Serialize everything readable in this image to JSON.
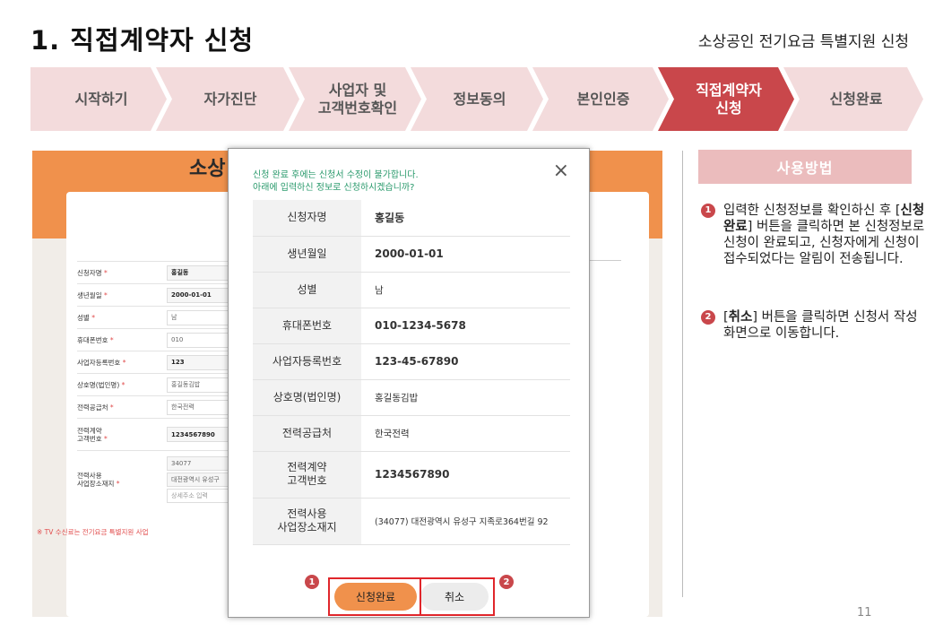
{
  "header": {
    "title": "1. 직접계약자 신청",
    "subtitle": "소상공인 전기요금 특별지원 신청"
  },
  "steps": [
    {
      "label": "시작하기",
      "active": false
    },
    {
      "label": "자가진단",
      "active": false
    },
    {
      "label": "사업자 및\n고객번호확인",
      "active": false
    },
    {
      "label": "정보동의",
      "active": false
    },
    {
      "label": "본인인증",
      "active": false
    },
    {
      "label": "직접계약자\n신청",
      "active": true
    },
    {
      "label": "신청완료",
      "active": false
    }
  ],
  "background_app": {
    "title": "소상",
    "form": [
      {
        "label": "신청자명",
        "value": "홍길동"
      },
      {
        "label": "생년월일",
        "value": "2000-01-01"
      },
      {
        "label": "성별",
        "value": "남"
      },
      {
        "label": "휴대폰번호",
        "value": "010"
      },
      {
        "label": "사업자등록번호",
        "value": "123"
      },
      {
        "label": "상호명(법인명)",
        "value": "홍길동김밥"
      },
      {
        "label": "전력공급처",
        "value": "한국전력"
      },
      {
        "label": "전력계약\n고객번호",
        "value": "1234567890"
      },
      {
        "label": "전력사용\n사업장소재지",
        "zip": "34077",
        "address": "대전광역시 유성구",
        "detail_placeholder": "상세주소 입력"
      }
    ],
    "required_mark": "*",
    "note": "※ TV 수신료는 전기요금 특별지원 사업"
  },
  "modal": {
    "message": "신청 완료 후에는 신청서 수정이 불가합니다.\n아래에 입력하신 정보로 신청하시겠습니까?",
    "close_icon": "×",
    "rows": [
      {
        "label": "신청자명",
        "value": "홍길동"
      },
      {
        "label": "생년월일",
        "value": "2000-01-01"
      },
      {
        "label": "성별",
        "value": "남"
      },
      {
        "label": "휴대폰번호",
        "value": "010-1234-5678"
      },
      {
        "label": "사업자등록번호",
        "value": "123-45-67890"
      },
      {
        "label": "상호명(법인명)",
        "value": "홍길동김밥"
      },
      {
        "label": "전력공급처",
        "value": "한국전력"
      },
      {
        "label": "전력계약\n고객번호",
        "value": "1234567890"
      },
      {
        "label": "전력사용\n사업장소재지",
        "value": "(34077) 대전광역시 유성구 지족로364번길 92"
      }
    ],
    "submit_label": "신청완료",
    "cancel_label": "취소",
    "marker_1": "1",
    "marker_2": "2"
  },
  "help": {
    "title": "사용방법",
    "items": [
      {
        "num": "1",
        "pre": "입력한 신청정보를 확인하신 후 [",
        "bold": "신청완료",
        "post": "] 버튼을 클릭하면 본 신청정보로 신청이 완료되고, 신청자에게 신청이 접수되었다는 알림이 전송됩니다."
      },
      {
        "num": "2",
        "pre": "[",
        "bold": "취소",
        "post": "] 버튼을 클릭하면 신청서 작성 화면으로 이동합니다."
      }
    ]
  },
  "page_number": "11",
  "colors": {
    "accent": "#c9474b",
    "step_bg": "#f3dbdc",
    "orange": "#f0914c",
    "green_msg": "#2a9a6c"
  }
}
